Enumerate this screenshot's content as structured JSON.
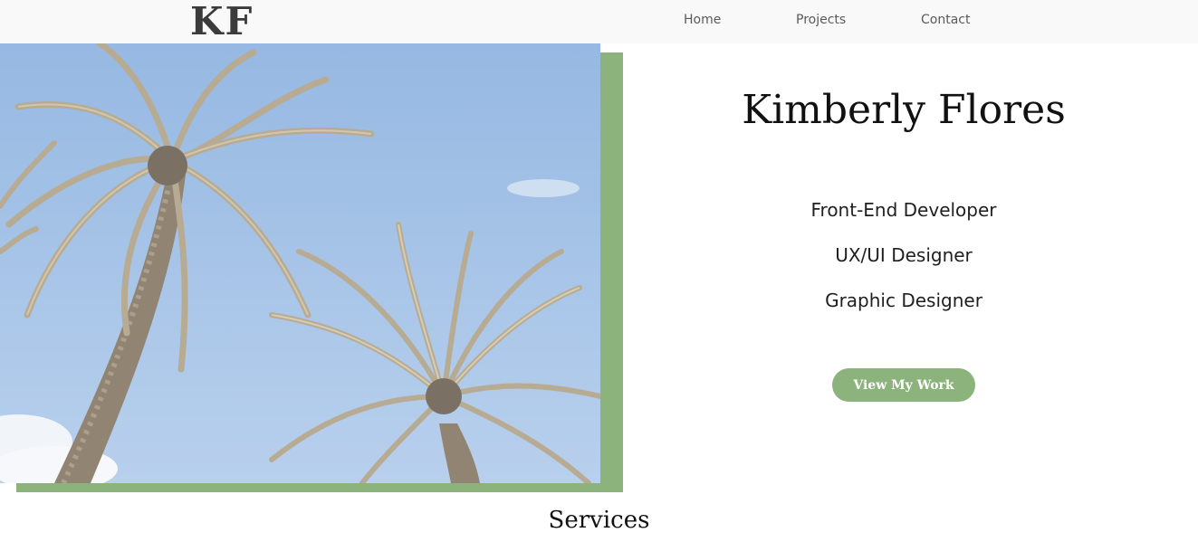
{
  "header": {
    "logo_text": "KF",
    "nav": {
      "home": "Home",
      "projects": "Projects",
      "contact": "Contact"
    }
  },
  "hero": {
    "image_subject": "palm trees against a blue sky",
    "name": "Kimberly Flores",
    "roles": [
      "Front-End Developer",
      "UX/UI Designer",
      "Graphic Designer"
    ],
    "cta_label": "View My Work"
  },
  "services": {
    "heading": "Services"
  },
  "colors": {
    "accent_green": "#8db37d",
    "sky_blue": "#8bb3e0",
    "header_bg": "#f9f9f9",
    "text_dark": "#111111"
  }
}
